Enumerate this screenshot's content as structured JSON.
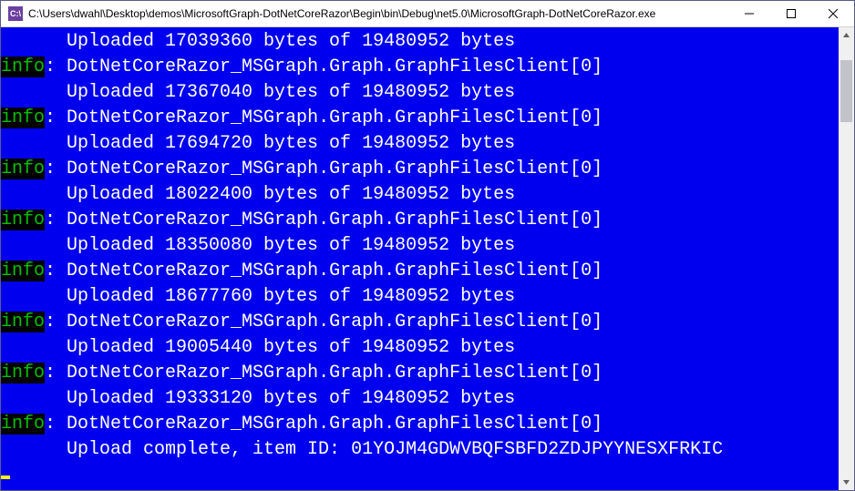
{
  "window": {
    "title": "C:\\Users\\dwahl\\Desktop\\demos\\MicrosoftGraph-DotNetCoreRazor\\Begin\\bin\\Debug\\net5.0\\MicrosoftGraph-DotNetCoreRazor.exe",
    "app_icon_text": "C:\\"
  },
  "console": {
    "info_label": "info",
    "logger_line": ": DotNetCoreRazor_MSGraph.Graph.GraphFilesClient[0]",
    "indent": "      ",
    "total_bytes": "19480952",
    "entries": [
      {
        "uploaded": "17039360"
      },
      {
        "uploaded": "17367040"
      },
      {
        "uploaded": "17694720"
      },
      {
        "uploaded": "18022400"
      },
      {
        "uploaded": "18350080"
      },
      {
        "uploaded": "18677760"
      },
      {
        "uploaded": "19005440"
      },
      {
        "uploaded": "19333120"
      }
    ],
    "complete_line": "Upload complete, item ID: 01YOJM4GDWVBQFSBFD2ZDJPYYNESXFRKIC"
  }
}
